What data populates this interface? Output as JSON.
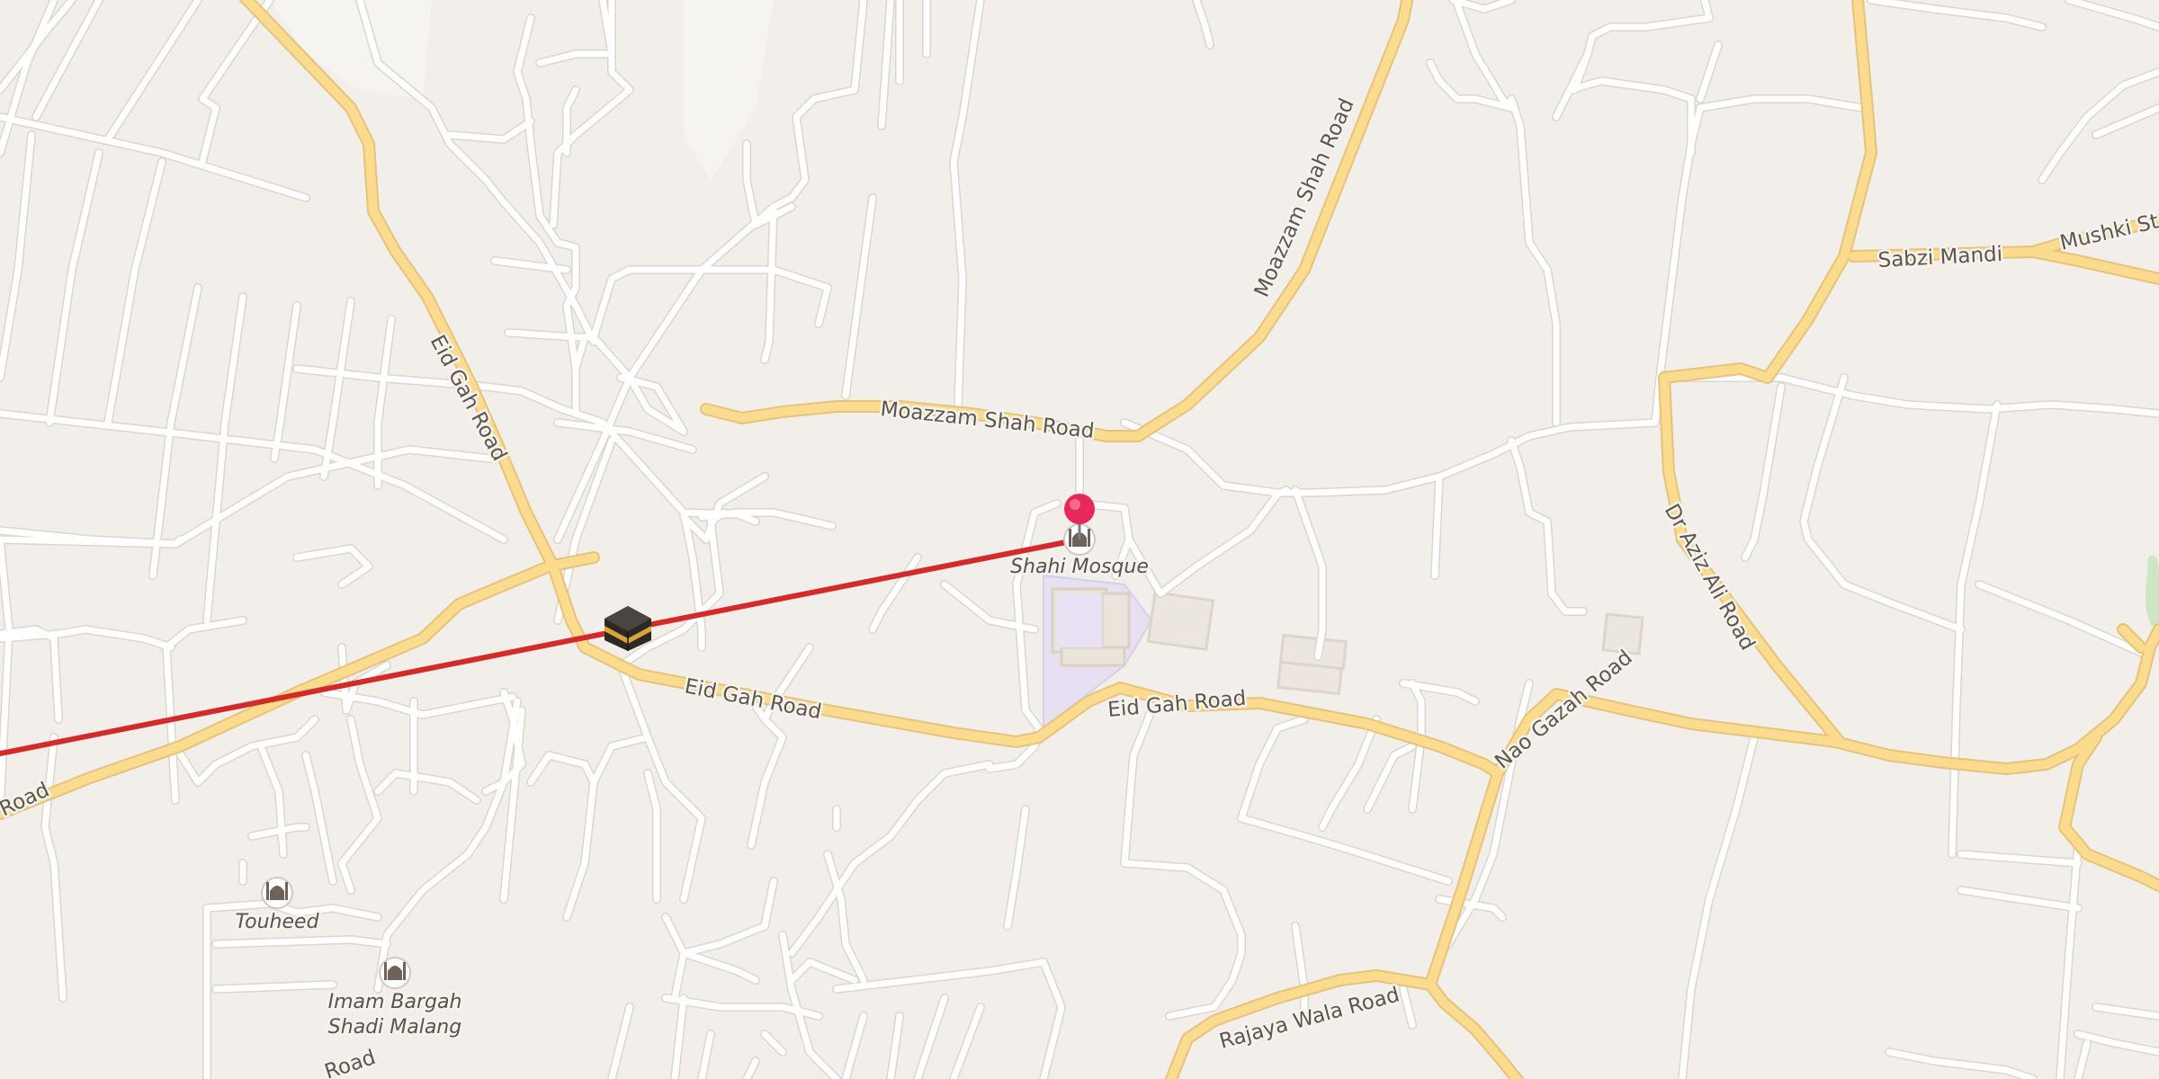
{
  "map": {
    "road_labels": {
      "eid_gah_1": "Eid Gah Road",
      "eid_gah_2": "Eid Gah Road",
      "eid_gah_3": "Eid Gah Road",
      "moazzam_1": "Moazzam Shah Road",
      "moazzam_2": "Moazzam Shah Road",
      "sabzi": "Sabzi Mandi",
      "mushki": "Mushki St",
      "aziz": "Dr Aziz Ali Road",
      "nao": "Nao Gazah Road",
      "rajaya": "Rajaya Wala Road",
      "road_left": "Road",
      "road_bottom_left": "Road"
    },
    "pois": {
      "shahi": "Shahi Mosque",
      "touheed": "Touheed",
      "imam_line1": "Imam Bargah",
      "imam_line2": "Shadi Malang"
    },
    "icons": {
      "pin": "location-pin-icon",
      "kaaba": "kaaba-icon",
      "mosque": "mosque-icon"
    },
    "colors": {
      "background": "#f2efeb",
      "minor_road": "#ffffff",
      "major_road": "#fbdc8e",
      "major_road_casing": "#e6c37c",
      "qibla_line": "#d42a2a",
      "pin": "#e8285a"
    }
  }
}
